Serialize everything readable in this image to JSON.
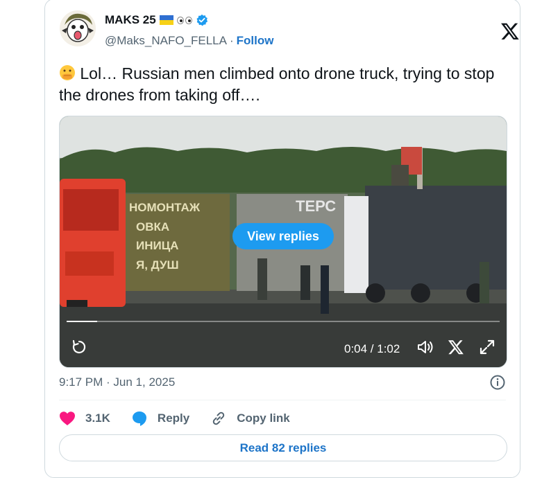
{
  "author": {
    "name": "MAKS 25",
    "handle": "@Maks_NAFO_FELLA",
    "separator": "·",
    "follow_label": "Follow"
  },
  "tweet": {
    "text": "Lol… Russian men climbed onto drone truck, trying to stop the drones from taking off…."
  },
  "media": {
    "overlay_button": "View replies",
    "time_display": "0:04 / 1:02",
    "progress": 0.07,
    "sign_text": [
      "НОМОНТАЖ",
      "ОВКА",
      "ИНИЦА",
      "Я, ДУШ"
    ],
    "sign_text_right": "ТЕРС"
  },
  "meta": {
    "timestamp": "9:17 PM · Jun 1, 2025"
  },
  "actions": {
    "likes": "3.1K",
    "reply_label": "Reply",
    "copy_link_label": "Copy link"
  },
  "read_replies_label": "Read 82 replies",
  "colors": {
    "accent": "#1d9bf0",
    "link": "#1d74c8",
    "heart": "#f91880"
  }
}
